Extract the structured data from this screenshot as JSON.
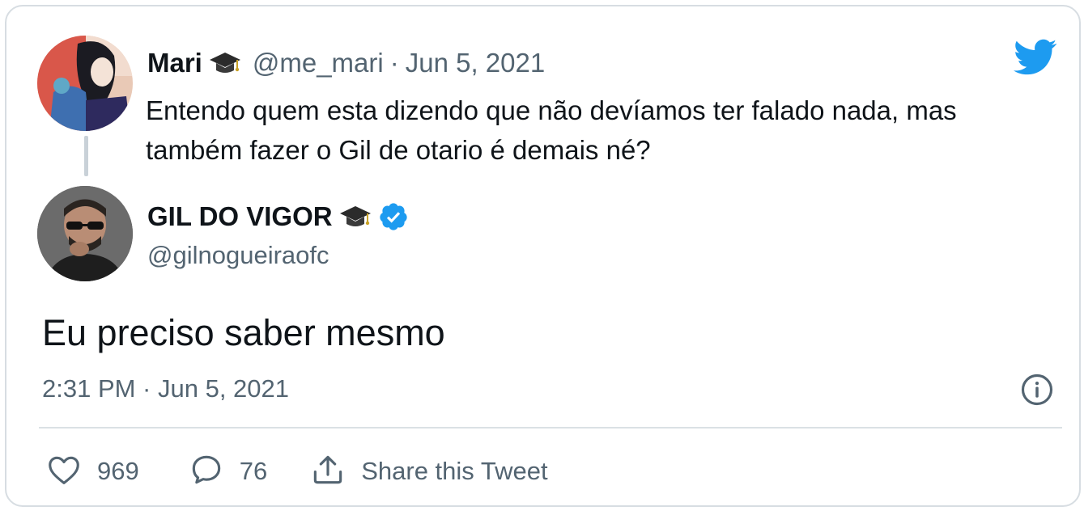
{
  "brand": {
    "accent": "#1d9bf0",
    "verified": "#1d9bf0",
    "text": "#0f1419",
    "muted": "#536471",
    "logo": "twitter-bird-icon"
  },
  "reply": {
    "name": "Mari",
    "badge": "graduation-cap-icon",
    "handle": "@me_mari",
    "separator": "·",
    "date": "Jun 5, 2021",
    "text": "Entendo quem esta dizendo que não devíamos ter falado nada, mas também fazer o Gil de otario é demais né?"
  },
  "tweet": {
    "name": "GIL DO VIGOR",
    "badge": "graduation-cap-icon",
    "verified_icon": "verified-badge-icon",
    "handle": "@gilnogueiraofc",
    "text": "Eu preciso saber mesmo",
    "timestamp": "2:31 PM · Jun 5, 2021",
    "info_icon": "info-icon"
  },
  "actions": {
    "likes": "969",
    "replies": "76",
    "share_label": "Share this Tweet"
  }
}
